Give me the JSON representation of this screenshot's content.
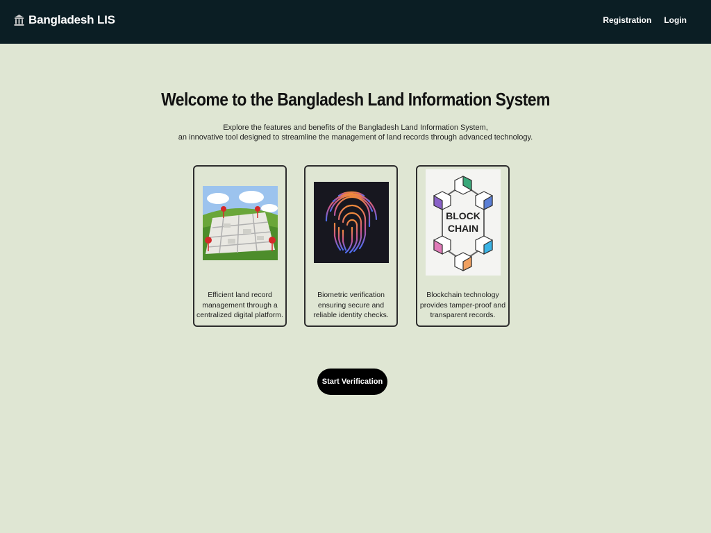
{
  "navbar": {
    "brand": "Bangladesh LIS",
    "brand_icon": "bank-building-icon",
    "links": [
      "Registration",
      "Login"
    ]
  },
  "hero": {
    "title": "Welcome to the Bangladesh Land Information System",
    "intro_line1": "Explore the features and benefits of the Bangladesh Land Information System,",
    "intro_line2": "an innovative tool designed to streamline the management of land records through advanced technology."
  },
  "features": [
    {
      "image": "land-map-illustration",
      "text": "Efficient land record management through a centralized digital platform."
    },
    {
      "image": "fingerprint-illustration",
      "text": "Biometric verification ensuring secure and reliable identity checks."
    },
    {
      "image": "blockchain-illustration",
      "image_text": [
        "BLOCK",
        "CHAIN"
      ],
      "text": "Blockchain technology provides tamper-proof and transparent records."
    }
  ],
  "cta": {
    "label": "Start Verification"
  },
  "colors": {
    "navbar_bg": "#0b1e24",
    "page_bg": "#dfe6d3",
    "button_bg": "#000000",
    "card_border": "#2d2d2d"
  }
}
